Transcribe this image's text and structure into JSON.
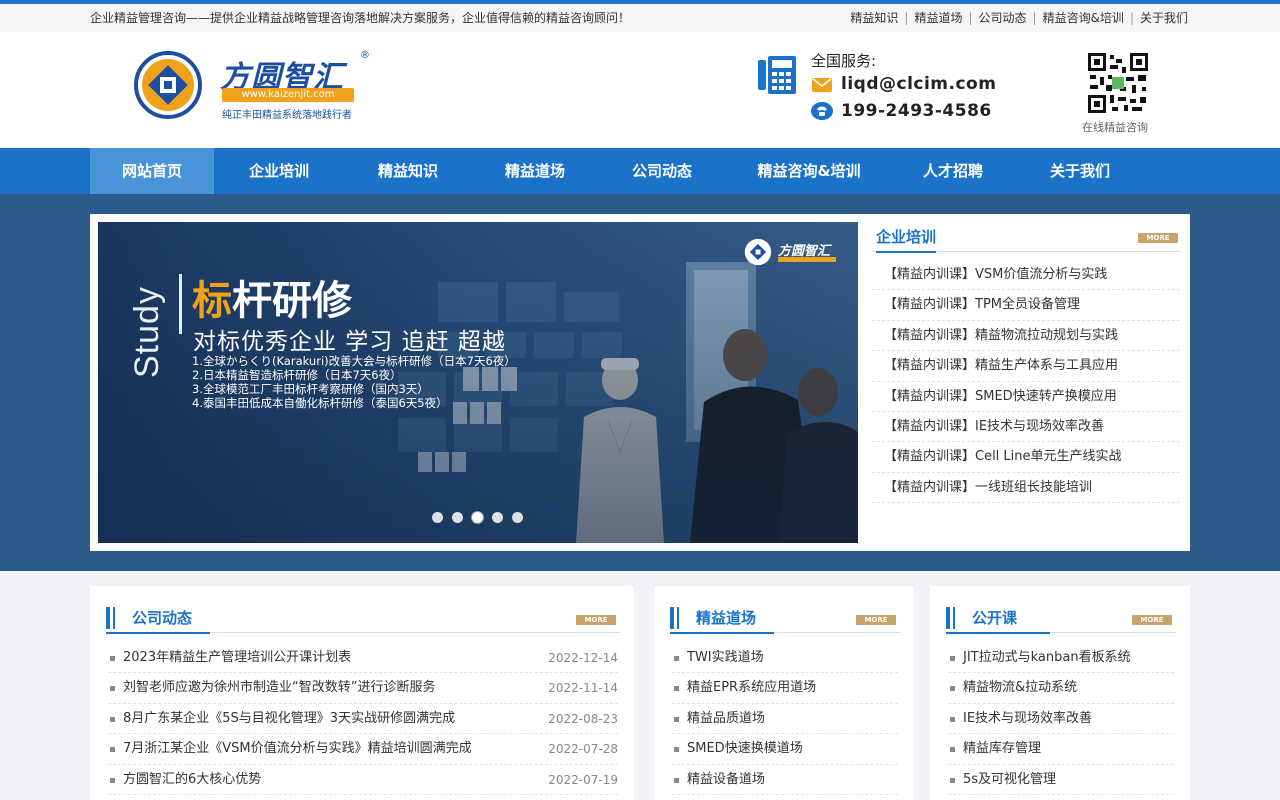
{
  "topbar": {
    "slogan": "企业精益管理咨询——提供企业精益战略管理咨询落地解决方案服务，企业值得信赖的精益咨询顾问！",
    "links": [
      "精益知识",
      "精益道场",
      "公司动态",
      "精益咨询&培训",
      "关于我们"
    ]
  },
  "header": {
    "logo_name": "方圆智汇",
    "logo_reg": "®",
    "logo_url": "www.kaizenjit.com",
    "logo_tagline": "纯正丰田精益系统落地践行者",
    "service_label": "全国服务:",
    "email": "liqd@clcim.com",
    "phone": "199-2493-4586",
    "qr_label": "在线精益咨询"
  },
  "nav": {
    "items": [
      "网站首页",
      "企业培训",
      "精益知识",
      "精益道场",
      "公司动态",
      "精益咨询&培训",
      "人才招聘",
      "关于我们"
    ],
    "active_index": 0
  },
  "banner": {
    "side_word": "Study",
    "title_first": "标",
    "title_rest": "杆研修",
    "subtitle": "对标优秀企业 学习 追赶 超越",
    "lines": [
      "1.全球からくり(Karakuri)改善大会与标杆研修（日本7天6夜）",
      "2.日本精益智造标杆研修（日本7天6夜）",
      "3.全球模范工厂丰田标杆考察研修（国内3天）",
      "4.泰国丰田低成本自働化标杆研修（泰国6天5夜）"
    ],
    "badge_name": "方圆智汇",
    "dots_count": 5,
    "active_dot": 2
  },
  "training": {
    "title": "企业培训",
    "more": "MORE",
    "items": [
      "【精益内训课】VSM价值流分析与实践",
      "【精益内训课】TPM全员设备管理",
      "【精益内训课】精益物流拉动规划与实践",
      "【精益内训课】精益生产体系与工具应用",
      "【精益内训课】SMED快速转产换模应用",
      "【精益内训课】IE技术与现场效率改善",
      "【精益内训课】Cell Line单元生产线实战",
      "【精益内训课】一线班组长技能培训"
    ]
  },
  "news": {
    "title": "公司动态",
    "more": "MORE",
    "items": [
      {
        "title": "2023年精益生产管理培训公开课计划表",
        "date": "2022-12-14"
      },
      {
        "title": "刘智老师应邀为徐州市制造业“智改数转”进行诊断服务",
        "date": "2022-11-14"
      },
      {
        "title": "8月广东某企业《5S与目视化管理》3天实战研修圆满完成",
        "date": "2022-08-23"
      },
      {
        "title": "7月浙江某企业《VSM价值流分析与实践》精益培训圆满完成",
        "date": "2022-07-28"
      },
      {
        "title": "方圆智汇的6大核心优势",
        "date": "2022-07-19"
      }
    ]
  },
  "dojo": {
    "title": "精益道场",
    "more": "MORE",
    "items": [
      "TWI实践道场",
      "精益EPR系统应用道场",
      "精益品质道场",
      "SMED快速换模道场",
      "精益设备道场"
    ]
  },
  "open_course": {
    "title": "公开课",
    "more": "MORE",
    "items": [
      "JIT拉动式与kanban看板系统",
      "精益物流&拉动系统",
      "IE技术与现场效率改善",
      "精益库存管理",
      "5s及可视化管理"
    ]
  },
  "colors": {
    "brand_blue": "#1a73c9",
    "banner_bg": "#2b5a8a",
    "accent_orange": "#f0a21c",
    "more_tag": "#c8a46a"
  }
}
